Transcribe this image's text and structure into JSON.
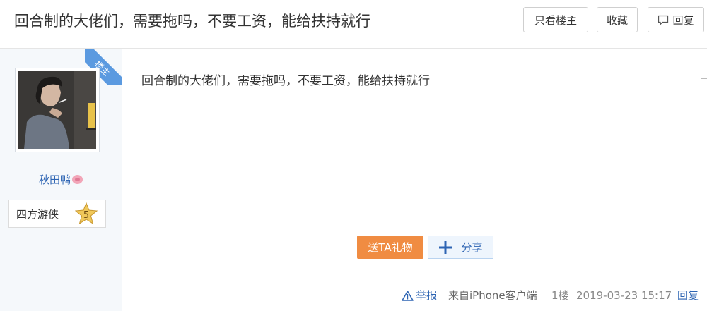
{
  "header": {
    "title": "回合制的大佬们，需要拖吗，不要工资，能给扶持就行",
    "only_op": "只看楼主",
    "favorite": "收藏",
    "reply": "回复"
  },
  "author": {
    "badge": "楼主",
    "name": "秋田鸭",
    "rank_title": "四方游侠",
    "level": "5"
  },
  "post": {
    "content": "回合制的大佬们，需要拖吗，不要工资，能给扶持就行",
    "gift": "送TA礼物",
    "share": "分享"
  },
  "footer": {
    "report": "举报",
    "source": "来自iPhone客户端",
    "floor": "1楼",
    "time": "2019-03-23 15:17",
    "reply": "回复"
  },
  "colors": {
    "link": "#2d64b3",
    "gift_bg": "#f08c42",
    "badge_bg": "#5b9ae0"
  }
}
